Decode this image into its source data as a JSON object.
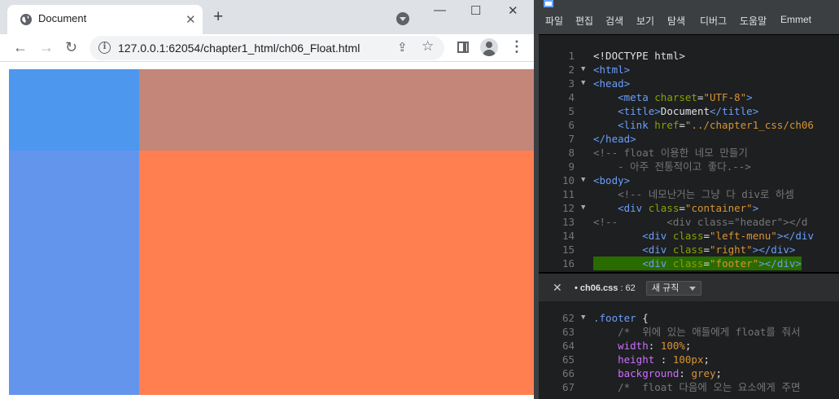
{
  "browser": {
    "tab_title": "Document",
    "tab_close": "✕",
    "new_tab": "+",
    "window_controls": [
      "—",
      "☐",
      "✕"
    ],
    "nav": {
      "back": "←",
      "forward": "→",
      "reload": "↻"
    },
    "url": "127.0.0.1:62054/chapter1_html/ch06_Float.html",
    "info_icon": "i",
    "share_icon": "⇪",
    "star_icon": "☆",
    "menu_icon": "⋮"
  },
  "page_colors": {
    "left_menu_top": "#4d97ef",
    "right_top": "#c38679",
    "left_menu": "#6495ed",
    "right": "#ff7f50"
  },
  "editor": {
    "menu": [
      "파일",
      "편집",
      "검색",
      "보기",
      "탐색",
      "디버그",
      "도움말",
      "Emmet"
    ],
    "code_lines": [
      {
        "n": "1",
        "fold": "",
        "parts": [
          [
            "",
            "<!DOCTYPE html>"
          ]
        ]
      },
      {
        "n": "2",
        "fold": "▼",
        "parts": [
          [
            "tag",
            "<html>"
          ]
        ]
      },
      {
        "n": "3",
        "fold": "▼",
        "parts": [
          [
            "tag",
            "<head>"
          ]
        ]
      },
      {
        "n": "4",
        "fold": "",
        "parts": [
          [
            "",
            "    "
          ],
          [
            "tag",
            "<meta "
          ],
          [
            "attr",
            "charset"
          ],
          [
            "",
            "="
          ],
          [
            "val",
            "\"UTF-8\""
          ],
          [
            "tag",
            ">"
          ]
        ]
      },
      {
        "n": "5",
        "fold": "",
        "parts": [
          [
            "",
            "    "
          ],
          [
            "tag",
            "<title>"
          ],
          [
            "",
            "Document"
          ],
          [
            "tag",
            "</title>"
          ]
        ]
      },
      {
        "n": "6",
        "fold": "",
        "parts": [
          [
            "",
            "    "
          ],
          [
            "tag",
            "<link "
          ],
          [
            "attr",
            "href"
          ],
          [
            "",
            "="
          ],
          [
            "val",
            "\"../chapter1_css/ch06"
          ]
        ]
      },
      {
        "n": "7",
        "fold": "",
        "parts": [
          [
            "tag",
            "</head>"
          ]
        ]
      },
      {
        "n": "8",
        "fold": "",
        "parts": [
          [
            "com",
            "<!-- float 이용한 네모 만들기"
          ]
        ]
      },
      {
        "n": "9",
        "fold": "",
        "parts": [
          [
            "com",
            "    - 아주 전통적이고 좋다.-->"
          ]
        ]
      },
      {
        "n": "10",
        "fold": "▼",
        "parts": [
          [
            "tag",
            "<body>"
          ]
        ]
      },
      {
        "n": "11",
        "fold": "",
        "parts": [
          [
            "com",
            "    <!-- 네모난거는 그냥 다 div로 하셈"
          ]
        ]
      },
      {
        "n": "12",
        "fold": "▼",
        "parts": [
          [
            "",
            "    "
          ],
          [
            "tag",
            "<div "
          ],
          [
            "attr",
            "class"
          ],
          [
            "",
            "="
          ],
          [
            "val",
            "\"container\""
          ],
          [
            "tag",
            ">"
          ]
        ]
      },
      {
        "n": "13",
        "fold": "",
        "parts": [
          [
            "com",
            "<!--        <div class=\"header\"></d"
          ]
        ]
      },
      {
        "n": "14",
        "fold": "",
        "parts": [
          [
            "",
            "        "
          ],
          [
            "tag",
            "<div "
          ],
          [
            "attr",
            "class"
          ],
          [
            "",
            "="
          ],
          [
            "val",
            "\"left-menu\""
          ],
          [
            "tag",
            "></div"
          ]
        ]
      },
      {
        "n": "15",
        "fold": "",
        "parts": [
          [
            "",
            "        "
          ],
          [
            "tag",
            "<div "
          ],
          [
            "attr",
            "class"
          ],
          [
            "",
            "="
          ],
          [
            "val",
            "\"right\""
          ],
          [
            "tag",
            "></div>"
          ]
        ]
      },
      {
        "n": "16",
        "fold": "",
        "hl": true,
        "parts": [
          [
            "",
            "        "
          ],
          [
            "tag",
            "<div "
          ],
          [
            "attr",
            "class"
          ],
          [
            "",
            "="
          ],
          [
            "val",
            "\"footer\""
          ],
          [
            "tag",
            "></div>"
          ]
        ]
      }
    ],
    "inline": {
      "close": "✕",
      "file": "• ch06.css",
      "line": " : 62",
      "rule_button": "새 규칙"
    },
    "css_lines": [
      {
        "n": "62",
        "fold": "▼",
        "parts": [
          [
            "sel",
            ".footer"
          ],
          [
            "",
            " {"
          ]
        ]
      },
      {
        "n": "63",
        "fold": "",
        "parts": [
          [
            "",
            "    "
          ],
          [
            "com",
            "/*  위에 있는 애들에게 float를 줘서"
          ]
        ]
      },
      {
        "n": "64",
        "fold": "",
        "parts": [
          [
            "",
            "    "
          ],
          [
            "prop",
            "width"
          ],
          [
            "",
            ": "
          ],
          [
            "num",
            "100%"
          ],
          [
            "",
            ";"
          ]
        ]
      },
      {
        "n": "65",
        "fold": "",
        "parts": [
          [
            "",
            "    "
          ],
          [
            "prop",
            "height"
          ],
          [
            "",
            " : "
          ],
          [
            "num",
            "100px"
          ],
          [
            "",
            ";"
          ]
        ]
      },
      {
        "n": "66",
        "fold": "",
        "parts": [
          [
            "",
            "    "
          ],
          [
            "prop",
            "background"
          ],
          [
            "",
            ": "
          ],
          [
            "num",
            "grey"
          ],
          [
            "",
            ";"
          ]
        ]
      },
      {
        "n": "67",
        "fold": "",
        "parts": [
          [
            "",
            "    "
          ],
          [
            "com",
            "/*  float 다음에 오는 요소에게 주면"
          ]
        ]
      }
    ]
  }
}
